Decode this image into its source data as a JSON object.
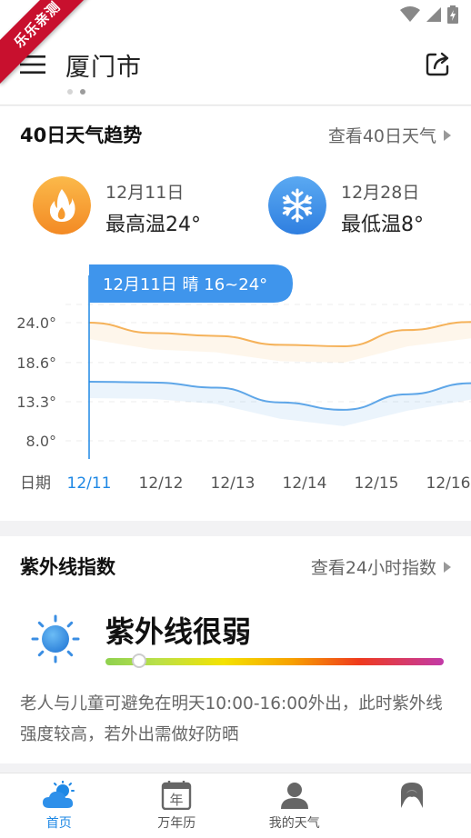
{
  "ribbon": {
    "text": "乐乐亲测"
  },
  "header": {
    "city": "厦门市"
  },
  "trend": {
    "title": "40日天气趋势",
    "link": "查看40日天气",
    "high": {
      "date": "12月11日",
      "value": "最高温24°"
    },
    "low": {
      "date": "12月28日",
      "value": "最低温8°"
    },
    "tooltip": "12月11日 晴 16~24°"
  },
  "chart_data": {
    "type": "line",
    "x_label": "日期",
    "categories": [
      "12/11",
      "12/12",
      "12/13",
      "12/14",
      "12/15",
      "12/16"
    ],
    "highlight_index": 0,
    "y_ticks": [
      "24.0°",
      "18.6°",
      "13.3°",
      "8.0°"
    ],
    "ylim": [
      8.0,
      24.0
    ],
    "series": [
      {
        "values": [
          24.0,
          22.6,
          22.2,
          21.0,
          20.8,
          23.0,
          24.1
        ],
        "color": "#f5b25a"
      },
      {
        "values": [
          16.0,
          15.9,
          15.2,
          13.2,
          12.2,
          14.3,
          15.8
        ],
        "color": "#5ea6e8"
      }
    ],
    "grid": true
  },
  "uv": {
    "title": "紫外线指数",
    "link": "查看24小时指数",
    "level": "紫外线很弱",
    "bar_position": 0.1,
    "description": "老人与儿童可避免在明天10:00-16:00外出，此时紫外线强度较高，若外出需做好防晒"
  },
  "nav": {
    "items": [
      {
        "label": "首页",
        "active": true
      },
      {
        "label": "万年历",
        "active": false
      },
      {
        "label": "我的天气",
        "active": false
      },
      {
        "label": "",
        "active": false
      }
    ]
  },
  "colors": {
    "accent": "#1e88e5",
    "hot": "#f7a33a",
    "cold": "#3b8eea"
  }
}
